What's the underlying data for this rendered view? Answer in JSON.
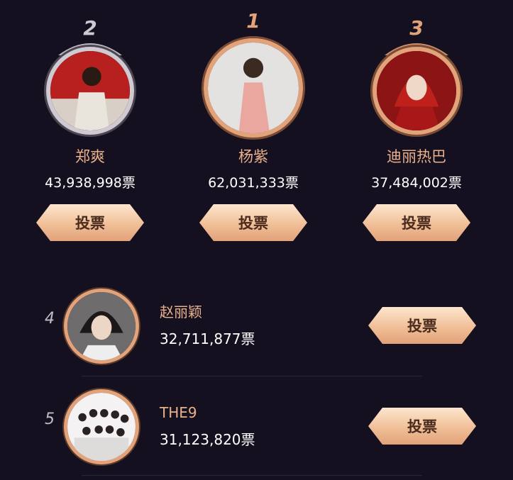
{
  "top_three": [
    {
      "rank": "2",
      "name": "郑爽",
      "votes": "43,938,998票",
      "vote_label": "投票"
    },
    {
      "rank": "1",
      "name": "杨紫",
      "votes": "62,031,333票",
      "vote_label": "投票"
    },
    {
      "rank": "3",
      "name": "迪丽热巴",
      "votes": "37,484,002票",
      "vote_label": "投票"
    }
  ],
  "list": [
    {
      "rank": "4",
      "name": "赵丽颖",
      "votes": "32,711,877票",
      "vote_label": "投票"
    },
    {
      "rank": "5",
      "name": "THE9",
      "votes": "31,123,820票",
      "vote_label": "投票"
    }
  ],
  "colors": {
    "background": "#15101f",
    "name_gold": "#eab08a",
    "gold_frame": "#e2a27a",
    "silver_frame": "#cfc9d2"
  }
}
